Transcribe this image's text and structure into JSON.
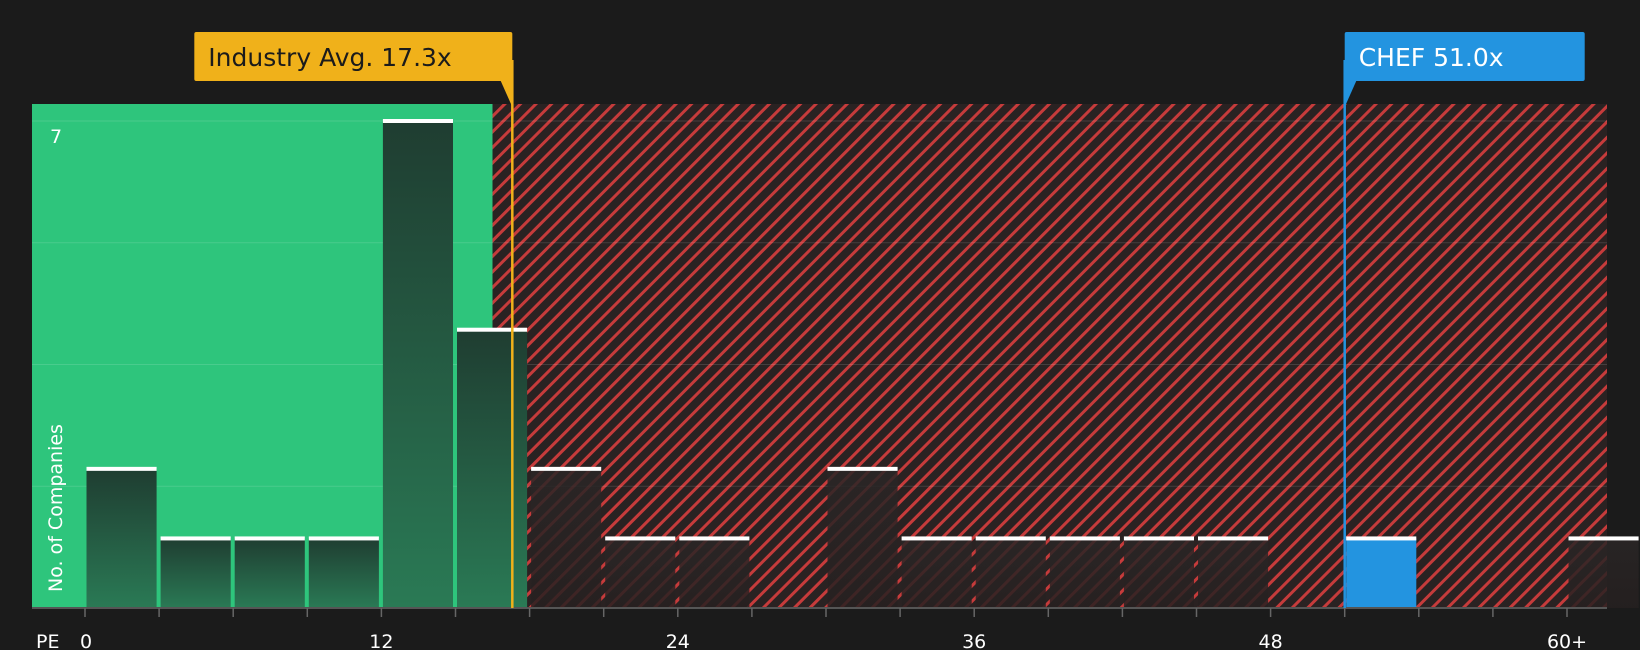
{
  "chart_data": {
    "type": "bar",
    "title": "",
    "xlabel": "PE",
    "ylabel": "No. of Companies",
    "x_ticks": [
      "0",
      "12",
      "24",
      "36",
      "48",
      "60+"
    ],
    "x_tick_values": [
      0,
      12,
      24,
      36,
      48,
      60
    ],
    "y_tick_labels": [
      "7"
    ],
    "y_tick_values": [
      7
    ],
    "xlim": [
      -2.2,
      61.5
    ],
    "ylim": [
      0,
      7.25
    ],
    "bin_width": 3,
    "bins": [
      {
        "x_start": 0,
        "count": 2
      },
      {
        "x_start": 3,
        "count": 1
      },
      {
        "x_start": 6,
        "count": 1
      },
      {
        "x_start": 9,
        "count": 1
      },
      {
        "x_start": 12,
        "count": 7
      },
      {
        "x_start": 15,
        "count": 4
      },
      {
        "x_start": 18,
        "count": 2
      },
      {
        "x_start": 21,
        "count": 1
      },
      {
        "x_start": 24,
        "count": 1
      },
      {
        "x_start": 30,
        "count": 2
      },
      {
        "x_start": 33,
        "count": 1
      },
      {
        "x_start": 36,
        "count": 1
      },
      {
        "x_start": 39,
        "count": 1
      },
      {
        "x_start": 42,
        "count": 1
      },
      {
        "x_start": 45,
        "count": 1
      },
      {
        "x_start": 51,
        "count": 1,
        "highlight": true
      },
      {
        "x_start": 60,
        "count": 1
      }
    ],
    "fair_zone_end": 16.5,
    "grid": true,
    "markers": [
      {
        "label": "Industry Avg. 17.3x",
        "value": 17.3,
        "color": "#f0b11a",
        "text_color": "#1b1b1b"
      },
      {
        "label": "CHEF 51.0x",
        "value": 51.0,
        "color": "#2394e0",
        "text_color": "#ffffff"
      }
    ]
  },
  "colors": {
    "background": "#1b1b1b",
    "fair_zone": "#2ec57c",
    "over_zone_base": "#2a2222",
    "over_zone_stripe": "#c63b3b",
    "bar_dark": "#1f3d31",
    "bar_gradient_bottom": "#2a7a55",
    "bar_cap": "#ffffff",
    "highlight_bar": "#2394e0"
  }
}
